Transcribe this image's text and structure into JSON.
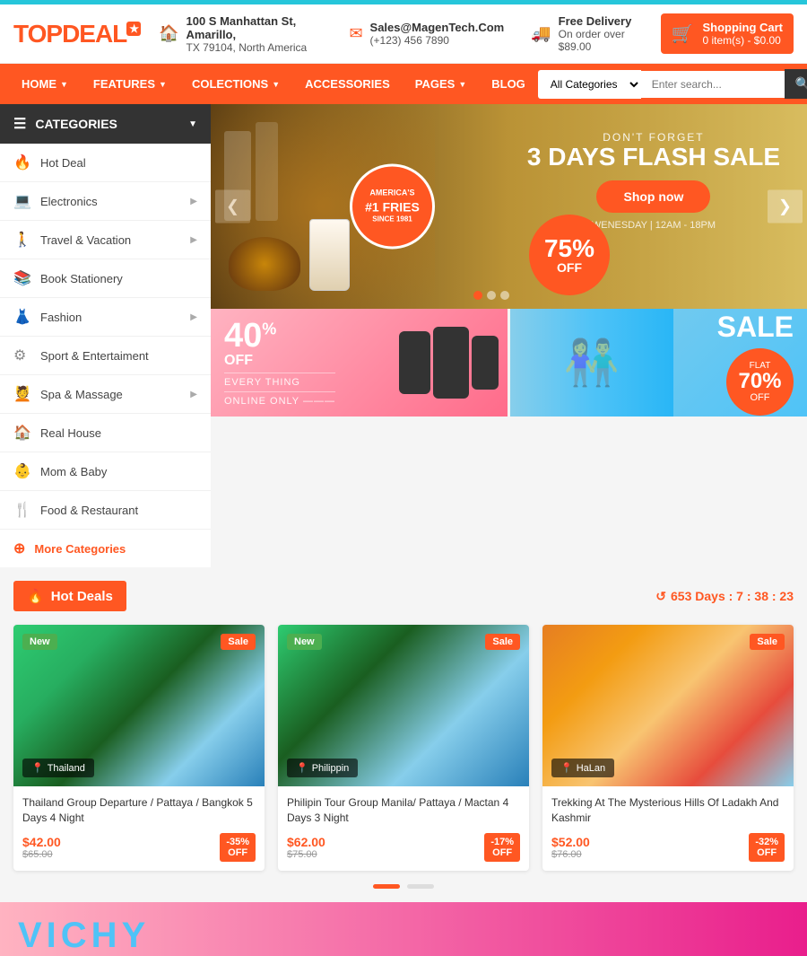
{
  "teal_bar": "",
  "header": {
    "logo_text": "TOP",
    "logo_accent": "DEAL",
    "logo_sup": "★",
    "address_icon": "🏠",
    "address_line1": "100 S Manhattan St, Amarillo,",
    "address_line2": "TX 79104, North America",
    "email_icon": "✉",
    "email_line1": "Sales@MagenTech.Com",
    "email_line2": "(+123) 456 7890",
    "delivery_icon": "🚚",
    "delivery_line1": "Free Delivery",
    "delivery_line2": "On order over $89.00",
    "cart_label": "Shopping Cart",
    "cart_items": "0 item(s) - $0.00"
  },
  "nav": {
    "items": [
      {
        "label": "HOME",
        "has_arrow": true
      },
      {
        "label": "FEATURES",
        "has_arrow": true
      },
      {
        "label": "COLECTIONS",
        "has_arrow": true
      },
      {
        "label": "ACCESSORIES",
        "has_arrow": false
      },
      {
        "label": "PAGES",
        "has_arrow": true
      },
      {
        "label": "BLOG",
        "has_arrow": false
      }
    ],
    "search_placeholder": "Enter search...",
    "search_categories": "All Categories"
  },
  "sidebar": {
    "header": "CATEGORIES",
    "items": [
      {
        "label": "Hot Deal",
        "icon": "🔥",
        "has_arrow": false
      },
      {
        "label": "Electronics",
        "icon": "💻",
        "has_arrow": true
      },
      {
        "label": "Travel & Vacation",
        "icon": "🚶",
        "has_arrow": true
      },
      {
        "label": "Book Stationery",
        "icon": "📚",
        "has_arrow": false
      },
      {
        "label": "Fashion",
        "icon": "👗",
        "has_arrow": true
      },
      {
        "label": "Sport & Entertaiment",
        "icon": "⚙",
        "has_arrow": false
      },
      {
        "label": "Spa & Massage",
        "icon": "💆",
        "has_arrow": true
      },
      {
        "label": "Real House",
        "icon": "🏠",
        "has_arrow": false
      },
      {
        "label": "Mom & Baby",
        "icon": "👶",
        "has_arrow": false
      },
      {
        "label": "Food & Restaurant",
        "icon": "🍴",
        "has_arrow": false
      }
    ],
    "more_label": "More Categories"
  },
  "hero": {
    "dont_forget": "DON'T FORGET",
    "title": "3 DAYS FLASH SALE",
    "shop_btn": "Shop now",
    "time_info": "WENESDAY | 12AM - 18PM",
    "badge_pct": "75%",
    "badge_off": "OFF",
    "america_badge": "AMERICA'S #1 FRIES SINCE 1981"
  },
  "sub_banner1": {
    "pct": "40",
    "sup": "%",
    "off": "OFF",
    "line1": "EVERY THING",
    "line2": "ONLINE ONLY ———"
  },
  "sub_banner2": {
    "sale": "SALE",
    "flat": "FLAT",
    "pct": "70%",
    "off": "OFF"
  },
  "hot_deals": {
    "title": "Hot Deals",
    "timer": "653 Days : 7 : 38 : 23",
    "products": [
      {
        "badge_new": "New",
        "badge_sale": "Sale",
        "location": "Thailand",
        "title": "Thailand Group Departure / Pattaya / Bangkok 5 Days 4 Night",
        "price_new": "$42.00",
        "price_old": "$65.00",
        "discount": "-35%\nOFF",
        "img_class": "img-thailand"
      },
      {
        "badge_new": "New",
        "badge_sale": "Sale",
        "location": "Philippin",
        "title": "Philipin Tour Group Manila/ Pattaya / Mactan 4 Days 3 Night",
        "price_new": "$62.00",
        "price_old": "$75.00",
        "discount": "-17%\nOFF",
        "img_class": "img-philippine"
      },
      {
        "badge_new": "",
        "badge_sale": "Sale",
        "location": "HaLan",
        "title": "Trekking At The Mysterious Hills Of Ladakh And Kashmir",
        "price_new": "$52.00",
        "price_old": "$76.00",
        "discount": "-32%\nOFF",
        "img_class": "img-holland"
      }
    ]
  },
  "carousel": {
    "dots": [
      "active",
      "inactive"
    ]
  },
  "bottom": {
    "vichy_text": "VICHY"
  }
}
